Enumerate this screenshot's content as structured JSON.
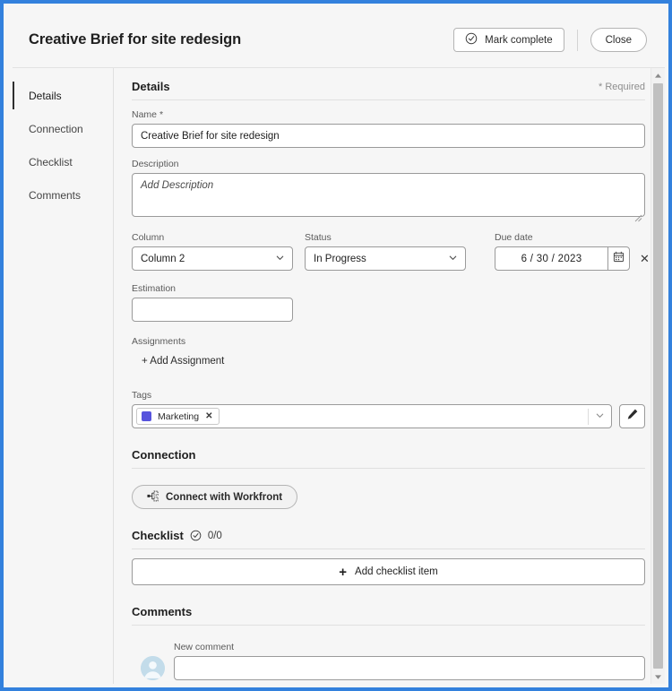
{
  "window": {
    "border_color": "#3381dd",
    "background": "#f6f6f6"
  },
  "header": {
    "title": "Creative Brief for site redesign",
    "mark_complete_label": "Mark complete",
    "close_label": "Close"
  },
  "sidebar": {
    "items": [
      {
        "label": "Details",
        "active": true
      },
      {
        "label": "Connection",
        "active": false
      },
      {
        "label": "Checklist",
        "active": false
      },
      {
        "label": "Comments",
        "active": false
      }
    ]
  },
  "details": {
    "section_title": "Details",
    "required_note": "* Required",
    "name_label": "Name",
    "name_required_mark": "*",
    "name_value": "Creative Brief for site redesign",
    "description_label": "Description",
    "description_value": "",
    "description_placeholder": "Add Description",
    "column_label": "Column",
    "column_value": "Column 2",
    "status_label": "Status",
    "status_value": "In Progress",
    "due_date_label": "Due date",
    "due_date_value": "6 / 30 / 2023",
    "due_date_clear_glyph": "✕",
    "estimation_label": "Estimation",
    "estimation_value": "",
    "assignments_label": "Assignments",
    "add_assignment_label": "+ Add Assignment",
    "tags_label": "Tags",
    "tags": [
      {
        "name": "Marketing",
        "color": "#5753dd",
        "remove_glyph": "✕"
      }
    ]
  },
  "connection": {
    "section_title": "Connection",
    "connect_button_label": "Connect with Workfront"
  },
  "checklist": {
    "section_title": "Checklist",
    "count": "0/0",
    "add_item_label": "Add checklist item",
    "add_item_plus": "+"
  },
  "comments": {
    "section_title": "Comments",
    "new_comment_label": "New comment",
    "new_comment_value": "",
    "new_comment_placeholder": ""
  },
  "icons": {
    "check_circle": "check-circle-icon",
    "calendar": "calendar-icon",
    "chevron_down": "chevron-down-icon",
    "pencil": "pencil-icon",
    "workfront_connect": "connection-nodes-icon",
    "avatar": "user-avatar-icon"
  },
  "scrollbar": {
    "up_label": "scroll-up",
    "down_label": "scroll-down"
  }
}
